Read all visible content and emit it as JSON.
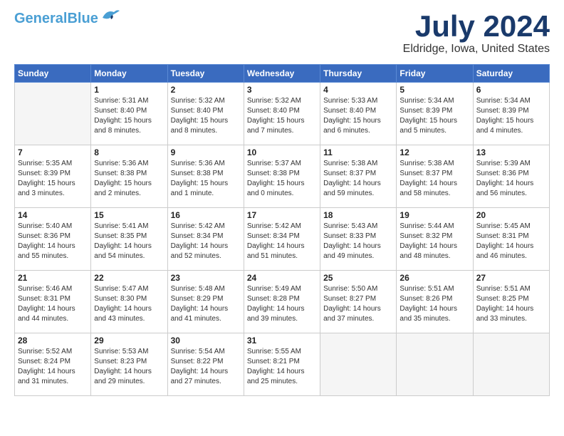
{
  "header": {
    "logo_line1": "General",
    "logo_line2": "Blue",
    "month_title": "July 2024",
    "location": "Eldridge, Iowa, United States"
  },
  "calendar": {
    "days_of_week": [
      "Sunday",
      "Monday",
      "Tuesday",
      "Wednesday",
      "Thursday",
      "Friday",
      "Saturday"
    ],
    "weeks": [
      [
        {
          "day": "",
          "sunrise": "",
          "sunset": "",
          "daylight": ""
        },
        {
          "day": "1",
          "sunrise": "Sunrise: 5:31 AM",
          "sunset": "Sunset: 8:40 PM",
          "daylight": "Daylight: 15 hours and 8 minutes."
        },
        {
          "day": "2",
          "sunrise": "Sunrise: 5:32 AM",
          "sunset": "Sunset: 8:40 PM",
          "daylight": "Daylight: 15 hours and 8 minutes."
        },
        {
          "day": "3",
          "sunrise": "Sunrise: 5:32 AM",
          "sunset": "Sunset: 8:40 PM",
          "daylight": "Daylight: 15 hours and 7 minutes."
        },
        {
          "day": "4",
          "sunrise": "Sunrise: 5:33 AM",
          "sunset": "Sunset: 8:40 PM",
          "daylight": "Daylight: 15 hours and 6 minutes."
        },
        {
          "day": "5",
          "sunrise": "Sunrise: 5:34 AM",
          "sunset": "Sunset: 8:39 PM",
          "daylight": "Daylight: 15 hours and 5 minutes."
        },
        {
          "day": "6",
          "sunrise": "Sunrise: 5:34 AM",
          "sunset": "Sunset: 8:39 PM",
          "daylight": "Daylight: 15 hours and 4 minutes."
        }
      ],
      [
        {
          "day": "7",
          "sunrise": "Sunrise: 5:35 AM",
          "sunset": "Sunset: 8:39 PM",
          "daylight": "Daylight: 15 hours and 3 minutes."
        },
        {
          "day": "8",
          "sunrise": "Sunrise: 5:36 AM",
          "sunset": "Sunset: 8:38 PM",
          "daylight": "Daylight: 15 hours and 2 minutes."
        },
        {
          "day": "9",
          "sunrise": "Sunrise: 5:36 AM",
          "sunset": "Sunset: 8:38 PM",
          "daylight": "Daylight: 15 hours and 1 minute."
        },
        {
          "day": "10",
          "sunrise": "Sunrise: 5:37 AM",
          "sunset": "Sunset: 8:38 PM",
          "daylight": "Daylight: 15 hours and 0 minutes."
        },
        {
          "day": "11",
          "sunrise": "Sunrise: 5:38 AM",
          "sunset": "Sunset: 8:37 PM",
          "daylight": "Daylight: 14 hours and 59 minutes."
        },
        {
          "day": "12",
          "sunrise": "Sunrise: 5:38 AM",
          "sunset": "Sunset: 8:37 PM",
          "daylight": "Daylight: 14 hours and 58 minutes."
        },
        {
          "day": "13",
          "sunrise": "Sunrise: 5:39 AM",
          "sunset": "Sunset: 8:36 PM",
          "daylight": "Daylight: 14 hours and 56 minutes."
        }
      ],
      [
        {
          "day": "14",
          "sunrise": "Sunrise: 5:40 AM",
          "sunset": "Sunset: 8:36 PM",
          "daylight": "Daylight: 14 hours and 55 minutes."
        },
        {
          "day": "15",
          "sunrise": "Sunrise: 5:41 AM",
          "sunset": "Sunset: 8:35 PM",
          "daylight": "Daylight: 14 hours and 54 minutes."
        },
        {
          "day": "16",
          "sunrise": "Sunrise: 5:42 AM",
          "sunset": "Sunset: 8:34 PM",
          "daylight": "Daylight: 14 hours and 52 minutes."
        },
        {
          "day": "17",
          "sunrise": "Sunrise: 5:42 AM",
          "sunset": "Sunset: 8:34 PM",
          "daylight": "Daylight: 14 hours and 51 minutes."
        },
        {
          "day": "18",
          "sunrise": "Sunrise: 5:43 AM",
          "sunset": "Sunset: 8:33 PM",
          "daylight": "Daylight: 14 hours and 49 minutes."
        },
        {
          "day": "19",
          "sunrise": "Sunrise: 5:44 AM",
          "sunset": "Sunset: 8:32 PM",
          "daylight": "Daylight: 14 hours and 48 minutes."
        },
        {
          "day": "20",
          "sunrise": "Sunrise: 5:45 AM",
          "sunset": "Sunset: 8:31 PM",
          "daylight": "Daylight: 14 hours and 46 minutes."
        }
      ],
      [
        {
          "day": "21",
          "sunrise": "Sunrise: 5:46 AM",
          "sunset": "Sunset: 8:31 PM",
          "daylight": "Daylight: 14 hours and 44 minutes."
        },
        {
          "day": "22",
          "sunrise": "Sunrise: 5:47 AM",
          "sunset": "Sunset: 8:30 PM",
          "daylight": "Daylight: 14 hours and 43 minutes."
        },
        {
          "day": "23",
          "sunrise": "Sunrise: 5:48 AM",
          "sunset": "Sunset: 8:29 PM",
          "daylight": "Daylight: 14 hours and 41 minutes."
        },
        {
          "day": "24",
          "sunrise": "Sunrise: 5:49 AM",
          "sunset": "Sunset: 8:28 PM",
          "daylight": "Daylight: 14 hours and 39 minutes."
        },
        {
          "day": "25",
          "sunrise": "Sunrise: 5:50 AM",
          "sunset": "Sunset: 8:27 PM",
          "daylight": "Daylight: 14 hours and 37 minutes."
        },
        {
          "day": "26",
          "sunrise": "Sunrise: 5:51 AM",
          "sunset": "Sunset: 8:26 PM",
          "daylight": "Daylight: 14 hours and 35 minutes."
        },
        {
          "day": "27",
          "sunrise": "Sunrise: 5:51 AM",
          "sunset": "Sunset: 8:25 PM",
          "daylight": "Daylight: 14 hours and 33 minutes."
        }
      ],
      [
        {
          "day": "28",
          "sunrise": "Sunrise: 5:52 AM",
          "sunset": "Sunset: 8:24 PM",
          "daylight": "Daylight: 14 hours and 31 minutes."
        },
        {
          "day": "29",
          "sunrise": "Sunrise: 5:53 AM",
          "sunset": "Sunset: 8:23 PM",
          "daylight": "Daylight: 14 hours and 29 minutes."
        },
        {
          "day": "30",
          "sunrise": "Sunrise: 5:54 AM",
          "sunset": "Sunset: 8:22 PM",
          "daylight": "Daylight: 14 hours and 27 minutes."
        },
        {
          "day": "31",
          "sunrise": "Sunrise: 5:55 AM",
          "sunset": "Sunset: 8:21 PM",
          "daylight": "Daylight: 14 hours and 25 minutes."
        },
        {
          "day": "",
          "sunrise": "",
          "sunset": "",
          "daylight": ""
        },
        {
          "day": "",
          "sunrise": "",
          "sunset": "",
          "daylight": ""
        },
        {
          "day": "",
          "sunrise": "",
          "sunset": "",
          "daylight": ""
        }
      ]
    ]
  }
}
